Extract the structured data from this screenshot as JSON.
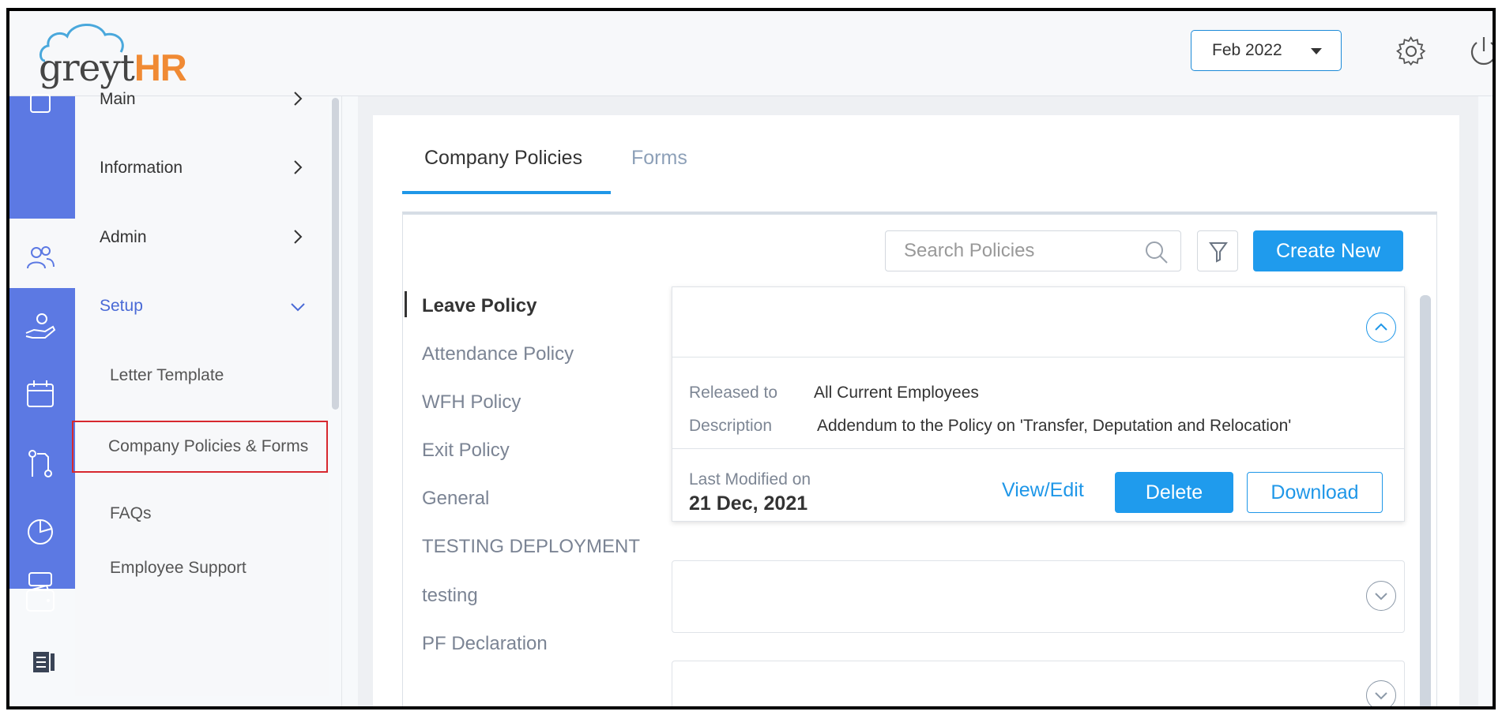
{
  "header": {
    "logo_grey": "greyt",
    "logo_hr": "HR",
    "month_selector": "Feb 2022",
    "icons": [
      "gear-icon",
      "power-icon"
    ]
  },
  "sidebar": {
    "items": [
      {
        "label": "Main",
        "icon": "home-icon"
      },
      {
        "label": "Information",
        "icon": "people-icon"
      },
      {
        "label": "Admin",
        "icon": "hand-icon"
      },
      {
        "label": "Setup",
        "icon": "calendar-icon",
        "expanded": true
      }
    ],
    "sub_items": [
      {
        "label": "Letter Template"
      },
      {
        "label": "Company Policies & Forms",
        "active": true
      },
      {
        "label": "FAQs"
      },
      {
        "label": "Employee Support"
      }
    ],
    "rail_icons": [
      "home-icon",
      "people-icon",
      "hand-icon",
      "calendar-icon",
      "workflow-icon",
      "pie-chart-icon",
      "wallet-icon",
      "device-icon"
    ]
  },
  "tabs": [
    {
      "label": "Company Policies",
      "active": true
    },
    {
      "label": "Forms",
      "active": false
    }
  ],
  "toolbar": {
    "search_placeholder": "Search Policies",
    "create_label": "Create New"
  },
  "policies": [
    {
      "label": "Leave Policy",
      "active": true
    },
    {
      "label": "Attendance Policy"
    },
    {
      "label": "WFH Policy"
    },
    {
      "label": "Exit Policy"
    },
    {
      "label": "General"
    },
    {
      "label": "TESTING DEPLOYMENT"
    },
    {
      "label": "testing"
    },
    {
      "label": "PF Declaration"
    }
  ],
  "expanded_policy": {
    "released_to_label": "Released to",
    "released_to_value": "All Current Employees",
    "description_label": "Description",
    "description_value": "Addendum to the Policy on 'Transfer, Deputation and Relocation'",
    "last_modified_label": "Last Modified on",
    "last_modified_value": "21 Dec, 2021",
    "view_edit_label": "View/Edit",
    "delete_label": "Delete",
    "download_label": "Download"
  },
  "colors": {
    "accent": "#1f9bed",
    "sidebar_rail": "#5c79e3",
    "active_outline": "#d7282f",
    "logo_orange": "#f08a34"
  }
}
